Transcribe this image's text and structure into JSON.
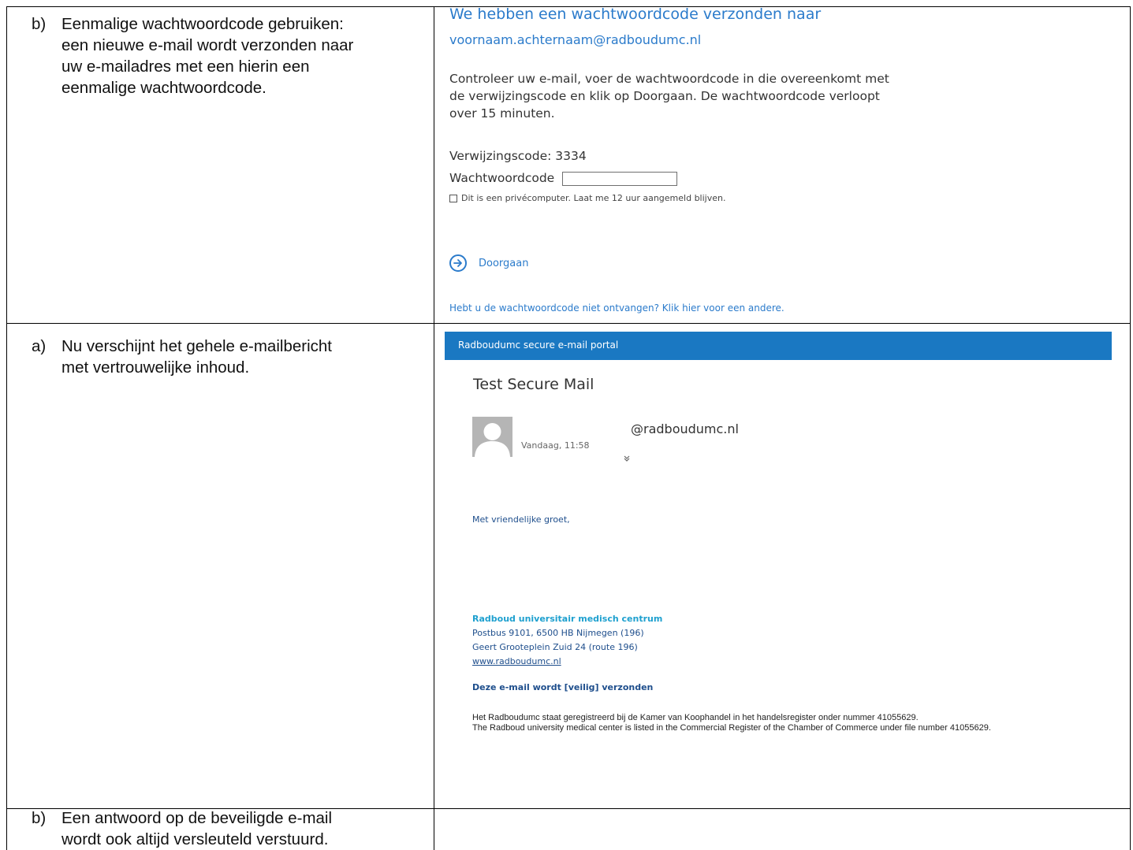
{
  "steps": [
    {
      "marker": "b)",
      "lines": [
        "Eenmalige wachtwoordcode gebruiken:",
        "een nieuwe e-mail wordt verzonden naar",
        "uw e-mailadres met een hierin een",
        "eenmalige wachtwoordcode."
      ]
    },
    {
      "marker": "a)",
      "lines": [
        "Nu verschijnt het gehele e-mailbericht",
        "met vertrouwelijke inhoud."
      ]
    },
    {
      "marker": "b)",
      "lines": [
        "Een antwoord op de beveiligde e-mail",
        "wordt ook altijd versleuteld verstuurd."
      ]
    }
  ],
  "otp_form": {
    "title": "We hebben een wachtwoordcode verzonden naar",
    "email": "voornaam.achternaam@radboudumc.nl",
    "instruction_lines": [
      "Controleer uw e-mail, voer de wachtwoordcode in die overeenkomt met",
      "de verwijzingscode en klik op Doorgaan. De wachtwoordcode verloopt",
      "over 15 minuten."
    ],
    "reference_label": "Verwijzingscode: 3334",
    "code_label": "Wachtwoordcode",
    "code_value": "",
    "remember_label": "Dit is een privécomputer. Laat me 12 uur aangemeld blijven.",
    "continue_label": "Doorgaan",
    "resend_link": "Hebt u de wachtwoordcode niet ontvangen? Klik hier voor een andere."
  },
  "portal": {
    "header_title": "Radboudumc secure e-mail portal",
    "subject": "Test Secure Mail",
    "sender": "@radboudumc.nl",
    "date": "Vandaag, 11:58",
    "expand_icon": "double-chevron-down",
    "greeting": "Met vriendelijke groet,",
    "org_name": "Radboud universitair medisch centrum",
    "address_lines": [
      "Postbus 9101, 6500 HB Nijmegen (196)",
      "Geert Grooteplein Zuid 24 (route 196)"
    ],
    "website": "www.radboudumc.nl",
    "secure_note": "Deze e-mail wordt [veilig] verzonden",
    "legal_lines": [
      "Het Radboudumc staat geregistreerd bij de Kamer van Koophandel in het handelsregister onder nummer 41055629.",
      "The Radboud university medical center is listed in the Commercial Register of the Chamber of Commerce under file number 41055629."
    ],
    "header_color": "#1a78c2"
  }
}
